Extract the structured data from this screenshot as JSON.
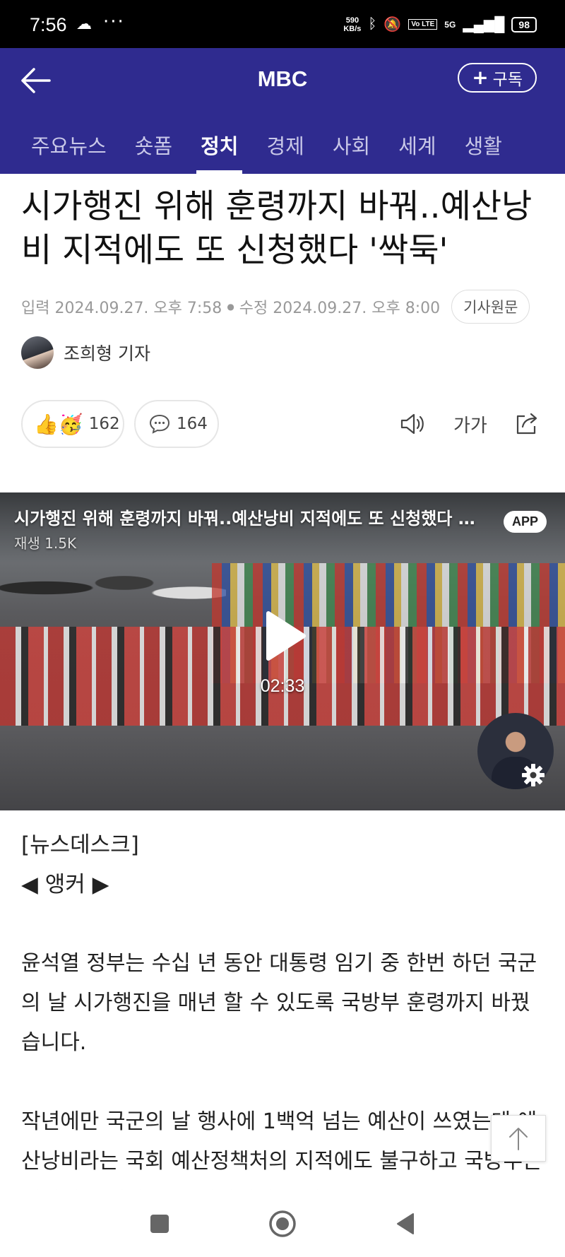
{
  "status_bar": {
    "time": "7:56",
    "cloud_icon": "cloud-icon",
    "more": "···",
    "net_speed_value": "590",
    "net_speed_unit": "KB/s",
    "volte": "Vo LTE",
    "network": "5G",
    "battery": "98"
  },
  "app_bar": {
    "title": "MBC",
    "subscribe_label": "구독",
    "bg_color": "#2f2b8f"
  },
  "tabs": [
    {
      "label": "주요뉴스",
      "active": false
    },
    {
      "label": "숏폼",
      "active": false
    },
    {
      "label": "정치",
      "active": true
    },
    {
      "label": "경제",
      "active": false
    },
    {
      "label": "사회",
      "active": false
    },
    {
      "label": "세계",
      "active": false
    },
    {
      "label": "생활",
      "active": false
    }
  ],
  "article": {
    "headline": "시가행진 위해 훈령까지 바꿔..예산낭비 지적에도 또 신청했다 '싹둑'",
    "published": "입력 2024.09.27. 오후 7:58",
    "modified": "수정 2024.09.27. 오후 8:00",
    "original_button": "기사원문",
    "reporter": "조희형 기자"
  },
  "actions": {
    "reaction_count": "162",
    "reaction_emojis": "👍🥳",
    "comment_count": "164",
    "font_size_label": "가가"
  },
  "video": {
    "title": "시가행진 위해 훈령까지 바꿔..예산낭비 지적에도 또 신청했다 '싹둑'",
    "views": "재생 1.5K",
    "app_badge": "APP",
    "duration": "02:33"
  },
  "body": {
    "desk": "[뉴스데스크]",
    "anchor": "◀ 앵커 ▶",
    "paragraphs": [
      "윤석열 정부는 수십 년 동안 대통령 임기 중 한번 하던 국군의 날 시가행진을 매년 할 수 있도록 국방부 훈령까지 바꿨습니다.",
      "작년에만 국군의 날 행사에 1백억 넘는 예산이 쓰였는데 예산낭비라는 국회 예산정책처의 지적에도 불구하고 국방부는 내년에도 예산을 또 잡았다가 호되"
    ]
  }
}
